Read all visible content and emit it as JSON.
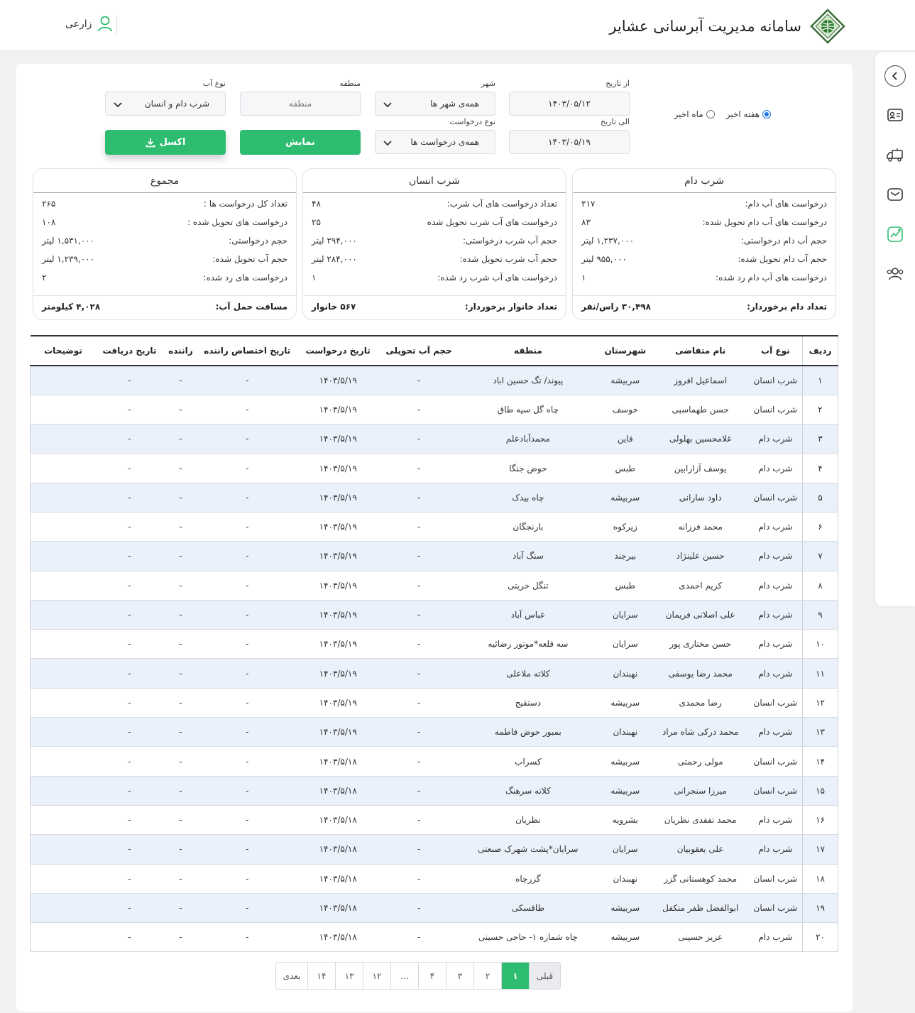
{
  "header": {
    "title": "سامانه مدیریت آبرسانی عشایر",
    "user_name": "زارعی"
  },
  "filters": {
    "range_week": "هفته اخیر",
    "range_month": "ماه اخیر",
    "from_date_label": "از تاریخ",
    "from_date_value": "۱۴۰۳/۰۵/۱۲",
    "to_date_label": "الی تاریخ",
    "to_date_value": "۱۴۰۳/۰۵/۱۹",
    "city_label": "شهر",
    "city_value": "همه‌ی شهر ها",
    "request_type_label": "نوع درخواست",
    "request_type_value": "همه‌ی درخواست ها",
    "region_label": "منطقه",
    "region_placeholder": "منطقه",
    "water_type_label": "نوع آب",
    "water_type_value": "شرب دام و انسان",
    "show_label": "نمایش",
    "excel_label": "اکسل"
  },
  "stats": {
    "livestock": {
      "title": "شرب دام",
      "rows": [
        {
          "label": "درخواست های آب دام:",
          "value": "۲۱۷"
        },
        {
          "label": "درخواست های آب دام تحویل شده:",
          "value": "۸۳"
        },
        {
          "label": "حجم آب دام درخواستی:",
          "value": "۱,۲۳۷,۰۰۰ لیتر"
        },
        {
          "label": "حجم آب دام تحویل شده:",
          "value": "۹۵۵,۰۰۰ لیتر"
        },
        {
          "label": "درخواست های آب دام رد شده:",
          "value": "۱"
        }
      ],
      "foot_label": "تعداد دام برخوردار:",
      "foot_value": "۳۰,۴۹۸ راس/نفر"
    },
    "human": {
      "title": "شرب انسان",
      "rows": [
        {
          "label": "تعداد درخواست های آب شرب:",
          "value": "۴۸"
        },
        {
          "label": "درخواست های آب شرب تحویل شده",
          "value": "۲۵"
        },
        {
          "label": "حجم آب شرب درخواستی:",
          "value": "۲۹۴,۰۰۰ لیتر"
        },
        {
          "label": "حجم آب شرب تحویل شده:",
          "value": "۲۸۴,۰۰۰ لیتر"
        },
        {
          "label": "درخواست های آب شرب رد شده:",
          "value": "۱"
        }
      ],
      "foot_label": "تعداد خانوار برخوردار:",
      "foot_value": "۵۶۷ خانوار"
    },
    "total": {
      "title": "مجموع",
      "rows": [
        {
          "label": "تعداد کل درخواست ها :",
          "value": "۲۶۵"
        },
        {
          "label": "درخواست های تحویل شده :",
          "value": "۱۰۸"
        },
        {
          "label": "حجم درخواستی:",
          "value": "۱,۵۳۱,۰۰۰ لیتر"
        },
        {
          "label": "حجم آب تحویل شده:",
          "value": "۱,۲۳۹,۰۰۰ لیتر"
        },
        {
          "label": "درخواست های رد شده:",
          "value": "۲"
        }
      ],
      "foot_label": "مسافت حمل آب:",
      "foot_value": "۴,۰۲۸ کیلومتر"
    }
  },
  "table": {
    "headers": [
      "ردیف",
      "نوع آب",
      "نام متقاضی",
      "شهرستان",
      "منطقه",
      "حجم آب تحویلی",
      "تاریخ درخواست",
      "تاریخ اختصاص راننده",
      "راننده",
      "تاریخ دریافت",
      "توضیحات"
    ],
    "rows": [
      [
        "۱",
        "شرب انسان",
        "اسماعیل افروز",
        "سربیشه",
        "پیوند/ تگ حسین اباد",
        "-",
        "۱۴۰۳/۵/۱۹",
        "-",
        "-",
        "-",
        ""
      ],
      [
        "۲",
        "شرب انسان",
        "حسن طهماسبی",
        "خوسف",
        "چاه گل سیه طاق",
        "-",
        "۱۴۰۳/۵/۱۹",
        "-",
        "-",
        "-",
        ""
      ],
      [
        "۳",
        "شرب دام",
        "غلامحسین بهلولی",
        "قاین",
        "محمدآبادعلم",
        "-",
        "۱۴۰۳/۵/۱۹",
        "-",
        "-",
        "-",
        ""
      ],
      [
        "۴",
        "شرب دام",
        "یوسف آزارابین",
        "طبس",
        "حوض جنگا",
        "-",
        "۱۴۰۳/۵/۱۹",
        "-",
        "-",
        "-",
        ""
      ],
      [
        "۵",
        "شرب انسان",
        "داود سارانی",
        "سربیشه",
        "چاه بیدک",
        "-",
        "۱۴۰۳/۵/۱۹",
        "-",
        "-",
        "-",
        ""
      ],
      [
        "۶",
        "شرب دام",
        "محمد فرزانه",
        "زیرکوه",
        "بارنجگان",
        "-",
        "۱۴۰۳/۵/۱۹",
        "-",
        "-",
        "-",
        ""
      ],
      [
        "۷",
        "شرب دام",
        "حسین علینژاد",
        "بیرجند",
        "سنگ آباد",
        "-",
        "۱۴۰۳/۵/۱۹",
        "-",
        "-",
        "-",
        ""
      ],
      [
        "۸",
        "شرب دام",
        "کریم احمدی",
        "طبس",
        "تنگل خریتی",
        "-",
        "۱۴۰۳/۵/۱۹",
        "-",
        "-",
        "-",
        ""
      ],
      [
        "۹",
        "شرب دام",
        "علی اصلانی فریمان",
        "سرایان",
        "عباس آباد",
        "-",
        "۱۴۰۳/۵/۱۹",
        "-",
        "-",
        "-",
        ""
      ],
      [
        "۱۰",
        "شرب دام",
        "حسن مختاری پور",
        "سرایان",
        "سه قلعه*موتور رضائیه",
        "-",
        "۱۴۰۳/۵/۱۹",
        "-",
        "-",
        "-",
        ""
      ],
      [
        "۱۱",
        "شرب دام",
        "محمد رضا یوسفی",
        "نهبندان",
        "کلاته ملاعلی",
        "-",
        "۱۴۰۳/۵/۱۹",
        "-",
        "-",
        "-",
        ""
      ],
      [
        "۱۲",
        "شرب انسان",
        "رضا محمدی",
        "سربیشه",
        "دستقیج",
        "-",
        "۱۴۰۳/۵/۱۹",
        "-",
        "-",
        "-",
        ""
      ],
      [
        "۱۳",
        "شرب دام",
        "محمد درکی شاه مراد",
        "نهبندان",
        "بمبور حوض فاطمه",
        "-",
        "۱۴۰۳/۵/۱۹",
        "-",
        "-",
        "-",
        ""
      ],
      [
        "۱۴",
        "شرب انسان",
        "مولی رحمتی",
        "سربیشه",
        "کسراب",
        "-",
        "۱۴۰۳/۵/۱۸",
        "-",
        "-",
        "-",
        ""
      ],
      [
        "۱۵",
        "شرب انسان",
        "میرزا سنجرانی",
        "سربیشه",
        "کلاته سرهنگ",
        "-",
        "۱۴۰۳/۵/۱۸",
        "-",
        "-",
        "-",
        ""
      ],
      [
        "۱۶",
        "شرب دام",
        "محمد تفقدی نظریان",
        "بشرویه",
        "نظریان",
        "-",
        "۱۴۰۳/۵/۱۸",
        "-",
        "-",
        "-",
        ""
      ],
      [
        "۱۷",
        "شرب دام",
        "علی یعقوبیان",
        "سرایان",
        "سرایان*پشت شهرک صنعتی",
        "-",
        "۱۴۰۳/۵/۱۸",
        "-",
        "-",
        "-",
        ""
      ],
      [
        "۱۸",
        "شرب انسان",
        "محمد کوهستانی گزر",
        "نهبندان",
        "گزرچاه",
        "-",
        "۱۴۰۳/۵/۱۸",
        "-",
        "-",
        "-",
        ""
      ],
      [
        "۱۹",
        "شرب انسان",
        "ابوالفضل ظفر متکفل",
        "سربیشه",
        "طاقسکی",
        "-",
        "۱۴۰۳/۵/۱۸",
        "-",
        "-",
        "-",
        ""
      ],
      [
        "۲۰",
        "شرب دام",
        "عزیز حسینی",
        "سربیشه",
        "چاه شماره ۱- حاجی حسینی",
        "-",
        "۱۴۰۳/۵/۱۸",
        "-",
        "-",
        "-",
        ""
      ]
    ]
  },
  "pagination": {
    "prev": "قبلی",
    "pages": [
      "۱",
      "۲",
      "۳",
      "۴",
      "...",
      "۱۲",
      "۱۳",
      "۱۴"
    ],
    "next": "بعدی",
    "current": "۱"
  },
  "colors": {
    "accent": "#2ebd70",
    "row_tint": "#eaf1fb",
    "radio_active": "#1a73e8"
  }
}
